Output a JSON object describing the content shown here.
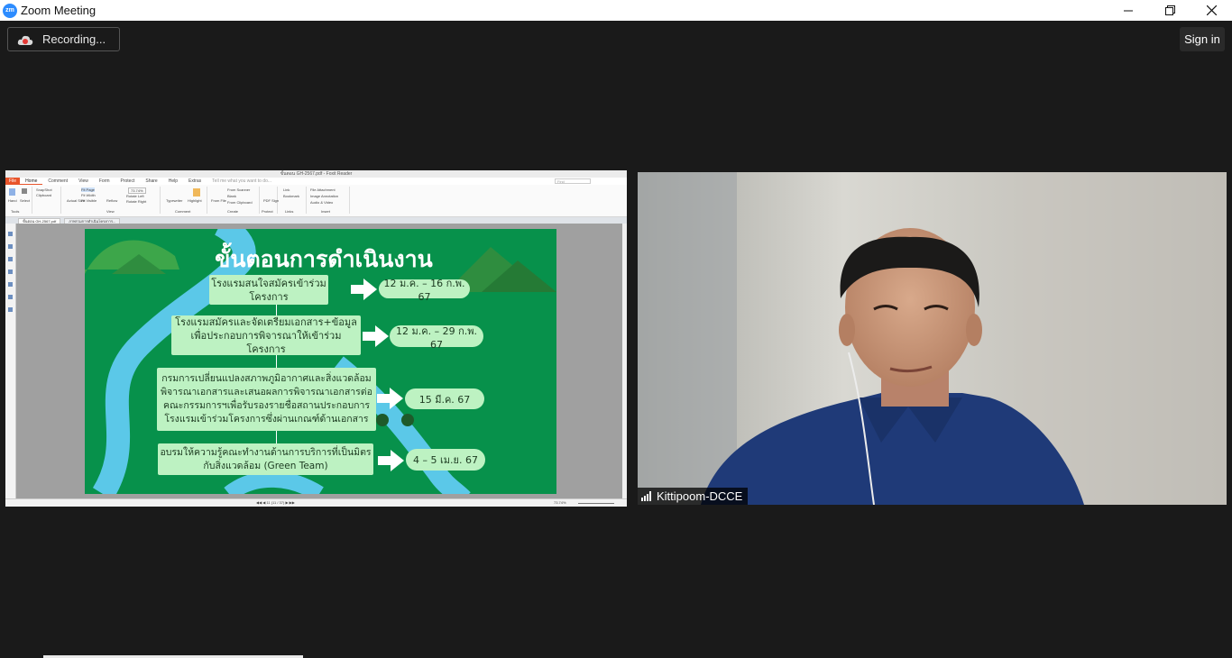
{
  "window": {
    "logo_text": "zm",
    "title": "Zoom Meeting",
    "controls": [
      "minimize",
      "restore",
      "close"
    ]
  },
  "toolbar": {
    "recording_label": "Recording...",
    "signin_label": "Sign in"
  },
  "shared_screen": {
    "reader_title": "ขั้นตอน GH-2567.pdf - Foxit Reader",
    "menu": [
      "File",
      "Home",
      "Comment",
      "View",
      "Form",
      "Protect",
      "Share",
      "Help",
      "Extras"
    ],
    "tell_me_placeholder": "Tell me what you want to do...",
    "find_placeholder": "Find",
    "ribbon": {
      "tools": [
        "Hand",
        "Select",
        "SnapShot",
        "Clipboard"
      ],
      "view": [
        "Actual Size",
        "Fit Page",
        "Fit Width",
        "Fit Visible",
        "Reflow",
        "Rotate Left",
        "Rotate Right"
      ],
      "zoom": "73.74%",
      "comment": [
        "Typewriter",
        "Highlight"
      ],
      "create": [
        "From File",
        "From Scanner",
        "Blank",
        "From Clipboard"
      ],
      "protect": [
        "PDF Sign"
      ],
      "links": [
        "Link",
        "Bookmark"
      ],
      "insert": [
        "File Attachment",
        "Image Annotation",
        "Audio & Video"
      ],
      "group_labels": [
        "Tools",
        "View",
        "Comment",
        "Create",
        "Protect",
        "Links",
        "Insert"
      ]
    },
    "tabs": [
      "ขั้นตอน GH-2567.pdf",
      "ภาพรวมการดำเนินโครงการ..."
    ],
    "page_indicator": "11 (11 / 37)",
    "status_zoom": "73.74%",
    "slide": {
      "title": "ขั้นตอนการดำเนินงาน",
      "steps": [
        {
          "text": "โรงแรมสนใจสมัครเข้าร่วม\nโครงการ",
          "date": "12 ม.ค. – 16 ก.พ. 67"
        },
        {
          "text": "โรงแรมสมัครและจัดเตรียมเอกสาร+ข้อมูล\nเพื่อประกอบการพิจารณาให้เข้าร่วมโครงการ",
          "date": "12 ม.ค. – 29 ก.พ. 67"
        },
        {
          "text": "กรมการเปลี่ยนแปลงสภาพภูมิอากาศและสิ่งแวดล้อม\nพิจารณาเอกสารและเสนอผลการพิจารณาเอกสารต่อ\nคณะกรรมการฯเพื่อรับรองรายชื่อสถานประกอบการ\nโรงแรมเข้าร่วมโครงการซึ่งผ่านเกณฑ์ด้านเอกสาร",
          "date": "15 มี.ค. 67"
        },
        {
          "text": "อบรมให้ความรู้คณะทำงานด้านการบริการที่เป็นมิตร\nกับสิ่งแวดล้อม (Green Team)",
          "date": "4 – 5 เม.ย. 67"
        }
      ],
      "colors": {
        "background": "#07914b",
        "box": "#bdf2c2",
        "river": "#5bc8e8"
      }
    }
  },
  "participant": {
    "name": "Kittipoom-DCCE"
  }
}
